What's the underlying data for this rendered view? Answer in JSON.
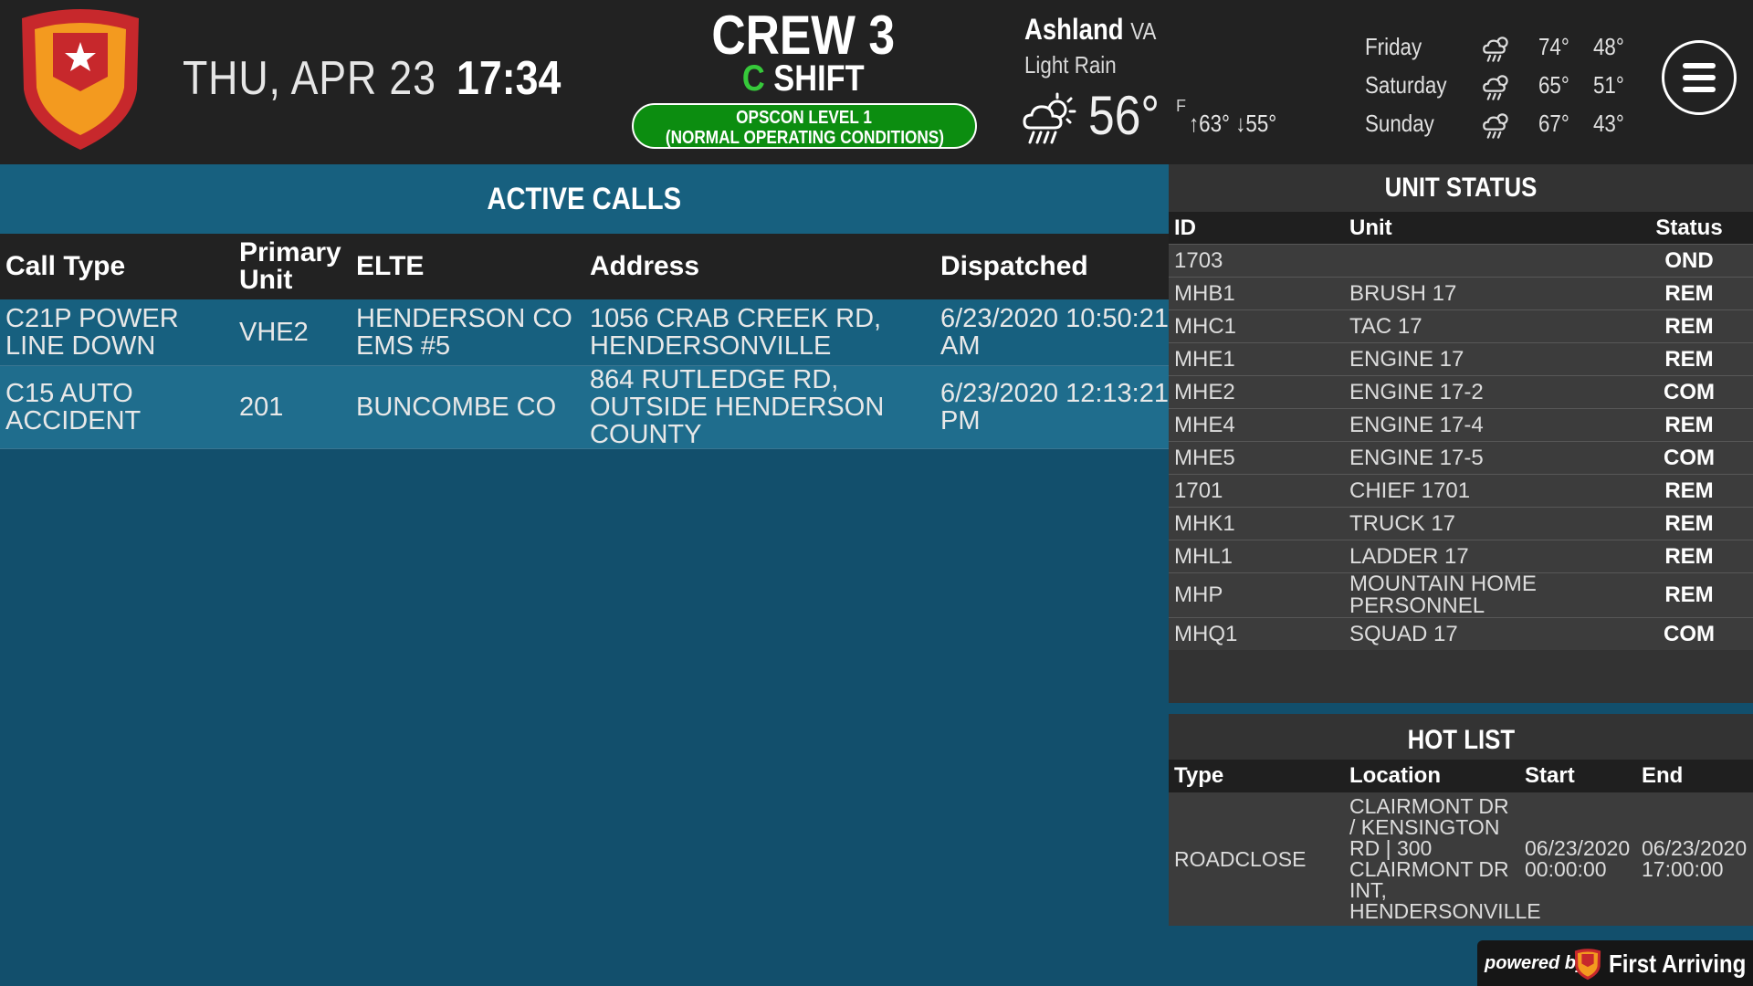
{
  "header": {
    "date": "THU, APR 23",
    "time": "17:34",
    "crew": "CREW 3",
    "shift_letter": "C",
    "shift_word": "SHIFT",
    "opscon_line1": "OPSCON LEVEL 1",
    "opscon_line2": "(NORMAL OPERATING CONDITIONS)",
    "accent_green": "#0c8d10"
  },
  "weather": {
    "city": "Ashland",
    "state": "VA",
    "condition": "Light Rain",
    "temp": "56°",
    "unit": "F",
    "high": "63°",
    "low": "55°",
    "icon": "rain-cloud-sun-icon",
    "forecast": [
      {
        "day": "Friday",
        "hi": "74°",
        "lo": "48°",
        "icon": "rain-cloud-sun-icon"
      },
      {
        "day": "Saturday",
        "hi": "65°",
        "lo": "51°",
        "icon": "rain-cloud-sun-icon"
      },
      {
        "day": "Sunday",
        "hi": "67°",
        "lo": "43°",
        "icon": "rain-cloud-sun-icon"
      }
    ]
  },
  "active_calls": {
    "title": "ACTIVE CALLS",
    "columns": [
      "Call Type",
      "Primary Unit",
      "ELTE",
      "Address",
      "Dispatched"
    ],
    "rows": [
      {
        "call_type": "C21P POWER LINE DOWN",
        "unit": "VHE2",
        "elte": "HENDERSON CO EMS #5",
        "address": "1056 CRAB CREEK RD, HENDERSONVILLE",
        "dispatched": "6/23/2020 10:50:21 AM"
      },
      {
        "call_type": "C15 AUTO ACCIDENT",
        "unit": "201",
        "elte": "BUNCOMBE CO",
        "address": "864 RUTLEDGE RD, OUTSIDE HENDERSON COUNTY",
        "dispatched": "6/23/2020 12:13:21 PM"
      }
    ]
  },
  "unit_status": {
    "title": "UNIT STATUS",
    "columns": [
      "ID",
      "Unit",
      "Status"
    ],
    "rows": [
      {
        "id": "1703",
        "unit": "",
        "status": "OND"
      },
      {
        "id": "MHB1",
        "unit": "BRUSH 17",
        "status": "REM"
      },
      {
        "id": "MHC1",
        "unit": "TAC 17",
        "status": "REM"
      },
      {
        "id": "MHE1",
        "unit": "ENGINE 17",
        "status": "REM"
      },
      {
        "id": "MHE2",
        "unit": "ENGINE 17-2",
        "status": "COM"
      },
      {
        "id": "MHE4",
        "unit": "ENGINE 17-4",
        "status": "REM"
      },
      {
        "id": "MHE5",
        "unit": "ENGINE 17-5",
        "status": "COM"
      },
      {
        "id": "1701",
        "unit": "CHIEF 1701",
        "status": "REM"
      },
      {
        "id": "MHK1",
        "unit": "TRUCK 17",
        "status": "REM"
      },
      {
        "id": "MHL1",
        "unit": "LADDER 17",
        "status": "REM"
      },
      {
        "id": "MHP",
        "unit": "MOUNTAIN HOME PERSONNEL",
        "status": "REM"
      },
      {
        "id": "MHQ1",
        "unit": "SQUAD 17",
        "status": "COM"
      }
    ]
  },
  "hot_list": {
    "title": "HOT LIST",
    "columns": [
      "Type",
      "Location",
      "Start",
      "End"
    ],
    "rows": [
      {
        "type": "ROADCLOSE",
        "location": "CLAIRMONT DR / KENSINGTON RD | 300 CLAIRMONT DR INT, HENDERSONVILLE",
        "start": "06/23/2020 00:00:00",
        "end": "06/23/2020 17:00:00"
      }
    ]
  },
  "footer": {
    "powered_by": "powered by",
    "brand": "First Arriving"
  }
}
